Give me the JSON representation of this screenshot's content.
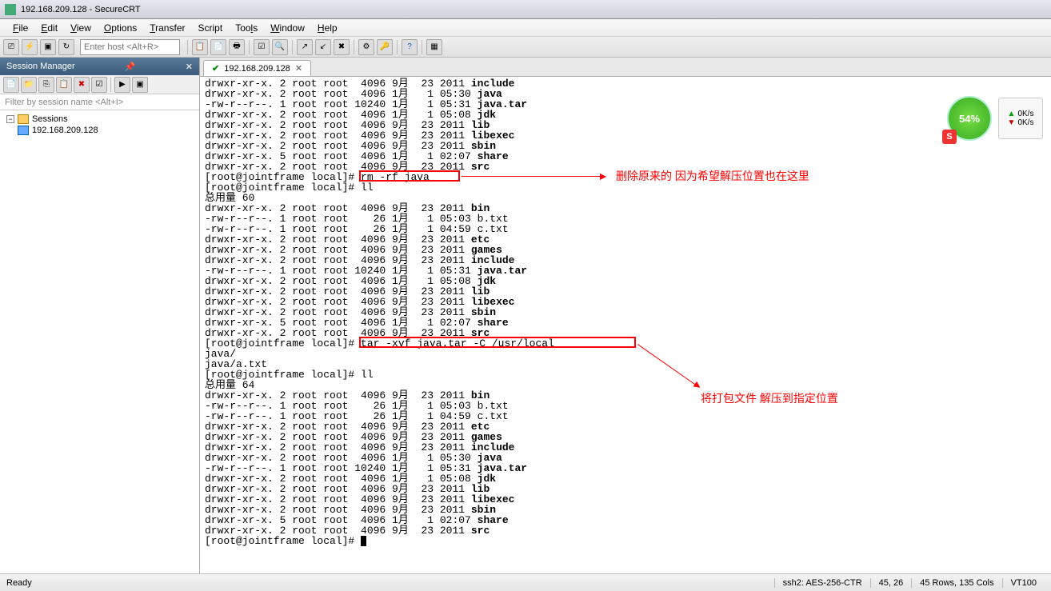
{
  "window": {
    "title": "192.168.209.128 - SecureCRT"
  },
  "menu": {
    "file": "File",
    "edit": "Edit",
    "view": "View",
    "options": "Options",
    "transfer": "Transfer",
    "script": "Script",
    "tools": "Tools",
    "window": "Window",
    "help": "Help"
  },
  "host_placeholder": "Enter host <Alt+R>",
  "session_manager": {
    "title": "Session Manager",
    "filter_placeholder": "Filter by session name <Alt+I>",
    "root": "Sessions",
    "items": [
      "192.168.209.128"
    ]
  },
  "tab": {
    "label": "192.168.209.128"
  },
  "terminal_lines": [
    {
      "pre": "drwxr-xr-x. 2 root root  4096 9月  23 2011 ",
      "b": "include"
    },
    {
      "pre": "drwxr-xr-x. 2 root root  4096 1月   1 05:30 ",
      "b": "java"
    },
    {
      "pre": "-rw-r--r--. 1 root root 10240 1月   1 05:31 ",
      "b": "java.tar"
    },
    {
      "pre": "drwxr-xr-x. 2 root root  4096 1月   1 05:08 ",
      "b": "jdk"
    },
    {
      "pre": "drwxr-xr-x. 2 root root  4096 9月  23 2011 ",
      "b": "lib"
    },
    {
      "pre": "drwxr-xr-x. 2 root root  4096 9月  23 2011 ",
      "b": "libexec"
    },
    {
      "pre": "drwxr-xr-x. 2 root root  4096 9月  23 2011 ",
      "b": "sbin"
    },
    {
      "pre": "drwxr-xr-x. 5 root root  4096 1月   1 02:07 ",
      "b": "share"
    },
    {
      "pre": "drwxr-xr-x. 2 root root  4096 9月  23 2011 ",
      "b": "src"
    },
    {
      "pre": "[root@jointframe local]# rm -rf java",
      "b": ""
    },
    {
      "pre": "[root@jointframe local]# ll",
      "b": ""
    },
    {
      "pre": "总用量 60",
      "b": ""
    },
    {
      "pre": "drwxr-xr-x. 2 root root  4096 9月  23 2011 ",
      "b": "bin"
    },
    {
      "pre": "-rw-r--r--. 1 root root    26 1月   1 05:03 b.txt",
      "b": ""
    },
    {
      "pre": "-rw-r--r--. 1 root root    26 1月   1 04:59 c.txt",
      "b": ""
    },
    {
      "pre": "drwxr-xr-x. 2 root root  4096 9月  23 2011 ",
      "b": "etc"
    },
    {
      "pre": "drwxr-xr-x. 2 root root  4096 9月  23 2011 ",
      "b": "games"
    },
    {
      "pre": "drwxr-xr-x. 2 root root  4096 9月  23 2011 ",
      "b": "include"
    },
    {
      "pre": "-rw-r--r--. 1 root root 10240 1月   1 05:31 ",
      "b": "java.tar"
    },
    {
      "pre": "drwxr-xr-x. 2 root root  4096 1月   1 05:08 ",
      "b": "jdk"
    },
    {
      "pre": "drwxr-xr-x. 2 root root  4096 9月  23 2011 ",
      "b": "lib"
    },
    {
      "pre": "drwxr-xr-x. 2 root root  4096 9月  23 2011 ",
      "b": "libexec"
    },
    {
      "pre": "drwxr-xr-x. 2 root root  4096 9月  23 2011 ",
      "b": "sbin"
    },
    {
      "pre": "drwxr-xr-x. 5 root root  4096 1月   1 02:07 ",
      "b": "share"
    },
    {
      "pre": "drwxr-xr-x. 2 root root  4096 9月  23 2011 ",
      "b": "src"
    },
    {
      "pre": "[root@jointframe local]# tar -xvf java.tar -C /usr/local",
      "b": ""
    },
    {
      "pre": "java/",
      "b": ""
    },
    {
      "pre": "java/a.txt",
      "b": ""
    },
    {
      "pre": "[root@jointframe local]# ll",
      "b": ""
    },
    {
      "pre": "总用量 64",
      "b": ""
    },
    {
      "pre": "drwxr-xr-x. 2 root root  4096 9月  23 2011 ",
      "b": "bin"
    },
    {
      "pre": "-rw-r--r--. 1 root root    26 1月   1 05:03 b.txt",
      "b": ""
    },
    {
      "pre": "-rw-r--r--. 1 root root    26 1月   1 04:59 c.txt",
      "b": ""
    },
    {
      "pre": "drwxr-xr-x. 2 root root  4096 9月  23 2011 ",
      "b": "etc"
    },
    {
      "pre": "drwxr-xr-x. 2 root root  4096 9月  23 2011 ",
      "b": "games"
    },
    {
      "pre": "drwxr-xr-x. 2 root root  4096 9月  23 2011 ",
      "b": "include"
    },
    {
      "pre": "drwxr-xr-x. 2 root root  4096 1月   1 05:30 ",
      "b": "java"
    },
    {
      "pre": "-rw-r--r--. 1 root root 10240 1月   1 05:31 ",
      "b": "java.tar"
    },
    {
      "pre": "drwxr-xr-x. 2 root root  4096 1月   1 05:08 ",
      "b": "jdk"
    },
    {
      "pre": "drwxr-xr-x. 2 root root  4096 9月  23 2011 ",
      "b": "lib"
    },
    {
      "pre": "drwxr-xr-x. 2 root root  4096 9月  23 2011 ",
      "b": "libexec"
    },
    {
      "pre": "drwxr-xr-x. 2 root root  4096 9月  23 2011 ",
      "b": "sbin"
    },
    {
      "pre": "drwxr-xr-x. 5 root root  4096 1月   1 02:07 ",
      "b": "share"
    },
    {
      "pre": "drwxr-xr-x. 2 root root  4096 9月  23 2011 ",
      "b": "src"
    },
    {
      "pre": "[root@jointframe local]# ",
      "b": "",
      "cursor": true
    }
  ],
  "annotations": {
    "a1": "删除原来的   因为希望解压位置也在这里",
    "a2": "将打包文件  解压到指定位置"
  },
  "statusbar": {
    "ready": "Ready",
    "ssh": "ssh2: AES-256-CTR",
    "pos": "45,  26",
    "size": "45 Rows, 135 Cols",
    "term": "VT100"
  },
  "widget": {
    "percent": "54%",
    "up": "0K/s",
    "down": "0K/s"
  }
}
